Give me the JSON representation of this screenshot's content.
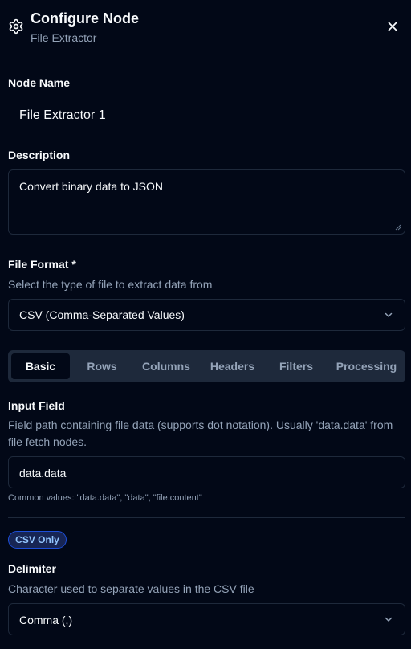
{
  "header": {
    "title": "Configure Node",
    "subtitle": "File Extractor",
    "icon": "gear-icon",
    "close_icon": "close-icon"
  },
  "node_name": {
    "label": "Node Name",
    "value": "File Extractor 1"
  },
  "description": {
    "label": "Description",
    "value": "Convert binary data to JSON"
  },
  "file_format": {
    "label": "File Format *",
    "help": "Select the type of file to extract data from",
    "selected": "CSV (Comma-Separated Values)"
  },
  "tabs": [
    {
      "label": "Basic",
      "active": true
    },
    {
      "label": "Rows",
      "active": false
    },
    {
      "label": "Columns",
      "active": false
    },
    {
      "label": "Headers",
      "active": false
    },
    {
      "label": "Filters",
      "active": false
    },
    {
      "label": "Processing",
      "active": false
    }
  ],
  "input_field": {
    "label": "Input Field",
    "help": "Field path containing file data (supports dot notation). Usually 'data.data' from file fetch nodes.",
    "value": "data.data",
    "hint": "Common values: \"data.data\", \"data\", \"file.content\""
  },
  "csv_badge": "CSV Only",
  "delimiter": {
    "label": "Delimiter",
    "help": "Character used to separate values in the CSV file",
    "selected": "Comma (,)"
  },
  "colors": {
    "background": "#020817",
    "border": "#1e293b",
    "muted_text": "#94a3b8",
    "badge_blue": "#93c5fd"
  }
}
